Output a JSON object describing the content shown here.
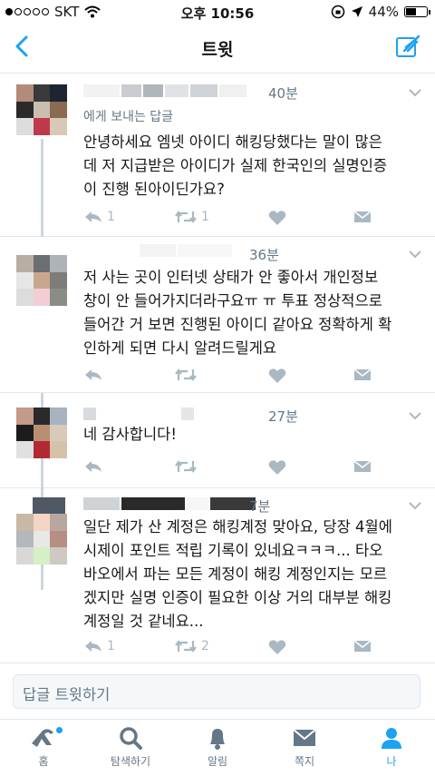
{
  "status_bar": {
    "carrier": "SKT",
    "time": "오후 10:56",
    "battery": "44%",
    "battery_level": 0.44
  },
  "nav": {
    "title": "트윗",
    "accent": "#1da1f2"
  },
  "tweets": [
    {
      "time": "40분",
      "reply_to": "에게 보내는 답글",
      "text": "안녕하세요 엠넷 아이디 해킹당했다는 말이 많은\n데 저 지급받은 아이디가 실제 한국인의 실명인증\n이 진행 된아이딘가요?",
      "reply_count": "1",
      "retweet_count": "1"
    },
    {
      "time": "36분",
      "reply_to": "",
      "text": "저 사는 곳이 인터넷 상태가 안 좋아서 개인정보\n창이 안 들어가지더라구요ㅠ ㅠ 투표 정상적으로\n들어간 거 보면 진행된 아이디 같아요 정확하게 확\n인하게 되면 다시 알려드릴게요",
      "reply_count": "",
      "retweet_count": ""
    },
    {
      "time": "27분",
      "reply_to": "",
      "text": "네 감사합니다!",
      "reply_count": "",
      "retweet_count": ""
    },
    {
      "time": "7분",
      "reply_to": "",
      "text": "일단 제가 산 계정은 해킹계정 맞아요, 당장 4월에\n시제이 포인트 적립 기록이 있네요ㅋㅋㅋ... 타오\n바오에서 파는 모든 계정이 해킹 계정인지는 모르\n겠지만 실명 인증이 필요한 이상 거의 대부분 해킹\n계정일 것 같네요...",
      "reply_count": "1",
      "retweet_count": "2"
    }
  ],
  "reply_bar": {
    "placeholder": "답글 트윗하기"
  },
  "tabs": [
    {
      "label": "홈",
      "icon": "home-icon"
    },
    {
      "label": "탐색하기",
      "icon": "search-icon"
    },
    {
      "label": "알림",
      "icon": "bell-icon"
    },
    {
      "label": "쪽지",
      "icon": "envelope-icon"
    },
    {
      "label": "나",
      "icon": "person-icon"
    }
  ]
}
